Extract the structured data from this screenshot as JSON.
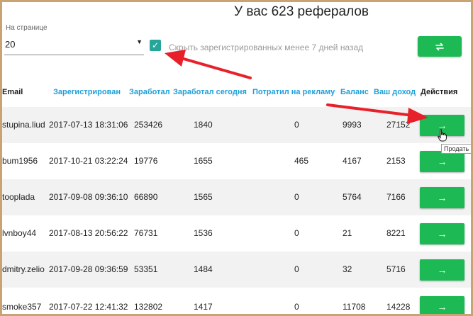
{
  "page_title": "У вас 623 рефералов",
  "per_page": {
    "label": "На странице",
    "value": "20"
  },
  "hide_option": {
    "checked": true,
    "label": "Скрыть зарегистрированных менее 7 дней назад"
  },
  "columns": {
    "email": "Email",
    "registered": "Зарегистрирован",
    "earned": "Заработал",
    "earned_today": "Заработал сегодня",
    "ad_spent": "Потратил на рекламу",
    "balance": "Баланс",
    "your_income": "Ваш доход",
    "actions": "Действия"
  },
  "rows": [
    {
      "email": "stupina.liud",
      "registered": "2017-07-13 18:31:06",
      "earned": "253426",
      "earned_today": "1840",
      "ad_spent": "0",
      "balance": "9993",
      "income": "27152",
      "action": "→"
    },
    {
      "email": "bum1956",
      "registered": "2017-10-21 03:22:24",
      "earned": "19776",
      "earned_today": "1655",
      "ad_spent": "465",
      "balance": "4167",
      "income": "2153",
      "action": "→"
    },
    {
      "email": "tooplada",
      "registered": "2017-09-08 09:36:10",
      "earned": "66890",
      "earned_today": "1565",
      "ad_spent": "0",
      "balance": "5764",
      "income": "7166",
      "action": "→"
    },
    {
      "email": "lvnboy44",
      "registered": "2017-08-13 20:56:22",
      "earned": "76731",
      "earned_today": "1536",
      "ad_spent": "0",
      "balance": "21",
      "income": "8221",
      "action": "→"
    },
    {
      "email": "dmitry.zelio",
      "registered": "2017-09-28 09:36:59",
      "earned": "53351",
      "earned_today": "1484",
      "ad_spent": "0",
      "balance": "32",
      "income": "5716",
      "action": "→"
    },
    {
      "email": "smoke357",
      "registered": "2017-07-22 12:41:32",
      "earned": "132802",
      "earned_today": "1417",
      "ad_spent": "0",
      "balance": "11708",
      "income": "14228",
      "action": "→"
    }
  ],
  "tooltip": "Продать",
  "colors": {
    "accent_green": "#1db954",
    "link_blue": "#1e9fd8",
    "checkbox_teal": "#26a69a",
    "annotation_red": "#e8202a"
  },
  "icons": {
    "refresh": "swap-arrows-icon",
    "action": "right-arrow-icon",
    "cursor": "hand-pointer-icon"
  }
}
